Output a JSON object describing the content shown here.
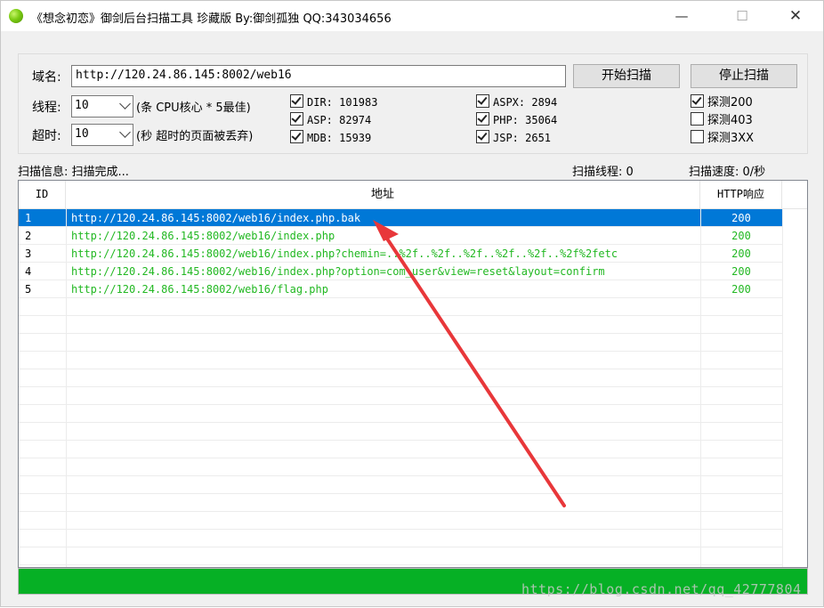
{
  "window": {
    "title": "《想念初恋》御剑后台扫描工具 珍藏版 By:御剑孤独 QQ:343034656",
    "minimize": "—",
    "maximize": "☐",
    "close": "✕"
  },
  "form": {
    "domain_label": "域名:",
    "domain_value": "http://120.24.86.145:8002/web16",
    "threads_label": "线程:",
    "threads_value": "10",
    "threads_hint": "(条 CPU核心 * 5最佳)",
    "timeout_label": "超时:",
    "timeout_value": "10",
    "timeout_hint": "(秒 超时的页面被丢弃)",
    "start_button": "开始扫描",
    "stop_button": "停止扫描"
  },
  "dictionaries": [
    {
      "label": "DIR: 101983",
      "checked": true
    },
    {
      "label": "ASP: 82974",
      "checked": true
    },
    {
      "label": "MDB: 15939",
      "checked": true
    },
    {
      "label": "ASPX: 2894",
      "checked": true
    },
    {
      "label": "PHP: 35064",
      "checked": true
    },
    {
      "label": "JSP: 2651",
      "checked": true
    }
  ],
  "probes": [
    {
      "label": "探测200",
      "checked": true
    },
    {
      "label": "探测403",
      "checked": false
    },
    {
      "label": "探测3XX",
      "checked": false
    }
  ],
  "status": {
    "info": "扫描信息: 扫描完成...",
    "threads": "扫描线程: 0",
    "speed": "扫描速度: 0/秒"
  },
  "table": {
    "columns": [
      "ID",
      "地址",
      "HTTP响应"
    ],
    "rows": [
      {
        "id": "1",
        "url": "http://120.24.86.145:8002/web16/index.php.bak",
        "code": "200",
        "selected": true
      },
      {
        "id": "2",
        "url": "http://120.24.86.145:8002/web16/index.php",
        "code": "200",
        "selected": false
      },
      {
        "id": "3",
        "url": "http://120.24.86.145:8002/web16/index.php?chemin=..%2f..%2f..%2f..%2f..%2f..%2f%2fetc",
        "code": "200",
        "selected": false
      },
      {
        "id": "4",
        "url": "http://120.24.86.145:8002/web16/index.php?option=com_user&view=reset&layout=confirm",
        "code": "200",
        "selected": false
      },
      {
        "id": "5",
        "url": "http://120.24.86.145:8002/web16/flag.php",
        "code": "200",
        "selected": false
      }
    ]
  },
  "progress": {
    "value": 1.0,
    "color": "#06b025"
  },
  "annotation": {
    "color": "#e8373a"
  },
  "watermark": "https://blog.csdn.net/qq_42777804"
}
